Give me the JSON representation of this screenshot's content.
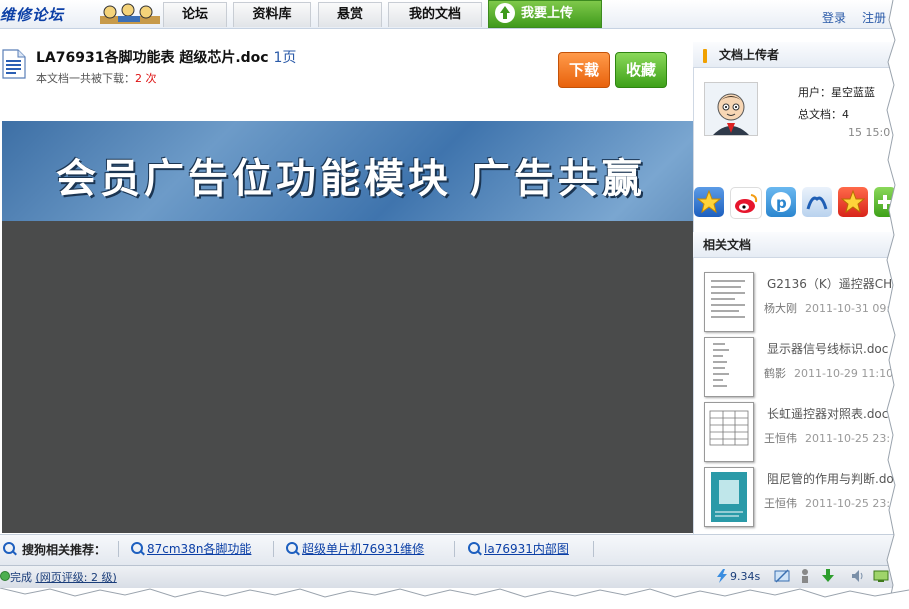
{
  "nav": {
    "logo_text": "维修论坛",
    "tabs": [
      "论坛",
      "资料库",
      "悬赏",
      "我的文档"
    ],
    "upload_tab": "我要上传",
    "login": "登录",
    "register": "注册"
  },
  "document": {
    "title": "LA76931各脚功能表 超级芯片.doc",
    "pages": "1页",
    "download_count_label": "本文档一共被下载：",
    "download_count": "2 次",
    "download_button": "下载",
    "favorite_button": "收藏"
  },
  "banner": {
    "text": "会员广告位功能模块   广告共赢"
  },
  "uploader": {
    "heading": "文档上传者",
    "user_line": "用户：星空蓝蓝",
    "docs_line": "总文档：4",
    "time_line": "15 15:0"
  },
  "share_icons": [
    "favorite-star-icon",
    "weibo-icon",
    "pinterest-icon",
    "renren-icon",
    "qzone-star-icon",
    "add-more-icon"
  ],
  "related": {
    "heading": "相关文档",
    "items": [
      {
        "title": "G2136（K）遥控器CH",
        "author": "杨大刚",
        "date": "2011-10-31 09:1"
      },
      {
        "title": "显示器信号线标识.doc",
        "author": "鹤影",
        "date": "2011-10-29 11:10"
      },
      {
        "title": "长虹遥控器对照表.doc",
        "author": "王恒伟",
        "date": "2011-10-25 23:"
      },
      {
        "title": "阻尼管的作用与判断.do",
        "author": "王恒伟",
        "date": "2011-10-25 23:"
      }
    ]
  },
  "search_bar": {
    "label": "搜狗相关推荐：",
    "links": [
      "87cm38n各脚功能",
      "超级单片机76931维修",
      "la76931内部图"
    ]
  },
  "status": {
    "done": "完成",
    "rating_link": "(网页评级: 2 级)",
    "time": "9.34s"
  },
  "colors": {
    "accent_blue": "#2a5aa8",
    "download_orange": "#e8620c",
    "favorite_green": "#3ea119",
    "dark_area": "#4a4b4b"
  }
}
